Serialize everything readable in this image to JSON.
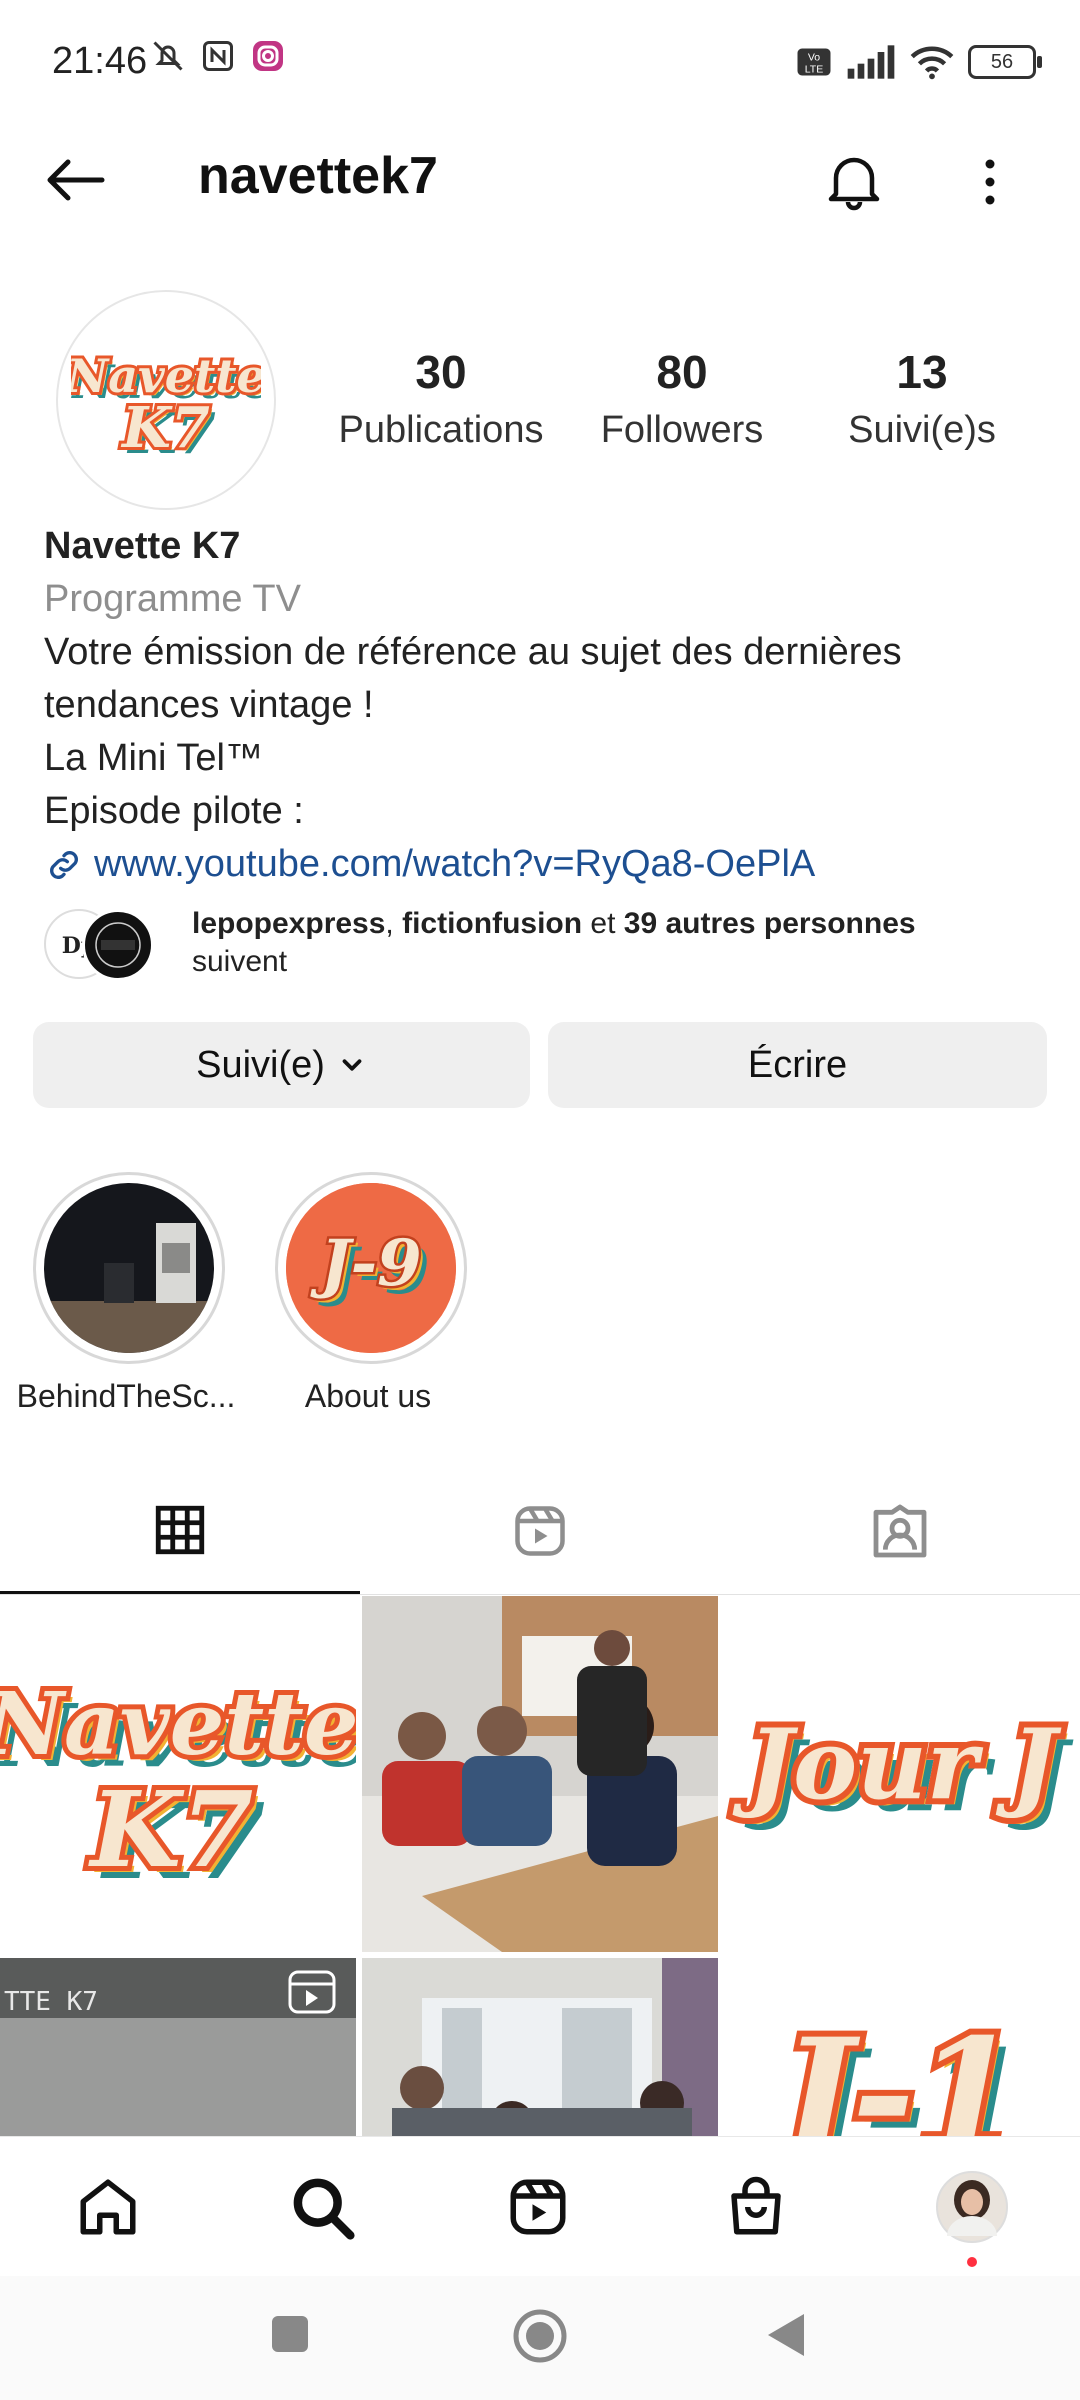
{
  "status_bar": {
    "time": "21:46",
    "battery": "56",
    "icons": [
      "mute-icon",
      "nfc-icon",
      "instagram-app-icon",
      "volte-icon",
      "signal-icon",
      "wifi-icon",
      "battery-icon"
    ]
  },
  "header": {
    "username": "navettek7",
    "icons": [
      "back-arrow-icon",
      "bell-icon",
      "more-vertical-icon"
    ]
  },
  "profile": {
    "avatar_text": [
      "Navette",
      "K7"
    ],
    "stats": [
      {
        "value": "30",
        "label": "Publications"
      },
      {
        "value": "80",
        "label": "Followers"
      },
      {
        "value": "13",
        "label": "Suivi(e)s"
      }
    ],
    "name": "Navette K7",
    "category": "Programme TV",
    "bio_lines": [
      "Votre émission de référence au sujet des dernières",
      "tendances vintage !",
      "La Mini Tel™",
      "Episode pilote :"
    ],
    "link": "www.youtube.com/watch?v=RyQa8-OePlA"
  },
  "followed_by": {
    "user1": "lepopexpress",
    "sep": ", ",
    "user2": "fictionfusion",
    "and_text": " et ",
    "others": "39 autres personnes",
    "suffix": "suivent"
  },
  "actions": {
    "follow_label": "Suivi(e)",
    "message_label": "Écrire"
  },
  "highlights": [
    {
      "label": "BehindTheSc...",
      "text": ""
    },
    {
      "label": "About us",
      "text": "J-9"
    }
  ],
  "tabs": [
    "grid-icon",
    "reels-icon",
    "tagged-icon"
  ],
  "grid": [
    {
      "type": "logo",
      "text": [
        "Navette",
        "K7"
      ]
    },
    {
      "type": "photo"
    },
    {
      "type": "logo",
      "text": [
        "Jour J"
      ]
    },
    {
      "type": "video",
      "text": "TTE K7"
    },
    {
      "type": "photo"
    },
    {
      "type": "logo",
      "text": [
        "J-1"
      ]
    }
  ],
  "colors": {
    "accent_orange": "#e8572a",
    "accent_yellow": "#f2b233",
    "accent_teal": "#2a8c8c",
    "cream": "#f7e6cf",
    "link_blue": "#1d4f91",
    "button_bg": "#efefef"
  }
}
